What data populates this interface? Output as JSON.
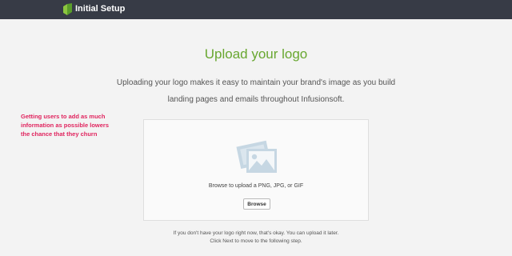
{
  "topbar": {
    "title": "Initial Setup",
    "logo_icon": "infusionsoft-logo-icon",
    "background": "#373b46"
  },
  "main": {
    "heading": "Upload your logo",
    "heading_color": "#68a730",
    "description_line1": "Uploading your logo makes it easy to maintain your brand's image as you build",
    "description_line2": "landing pages and emails throughout Infusionsoft."
  },
  "annotation": {
    "line1": "Getting users to add as much",
    "line2": "information as possible lowers",
    "line3": "the chance that they churn",
    "color": "#e0245e"
  },
  "upload": {
    "icon": "image-placeholder-icon",
    "hint": "Browse to upload a PNG, JPG, or GIF",
    "browse_label": "Browse"
  },
  "footer": {
    "line1": "If you don't have your logo right now, that's okay. You can upload it later.",
    "line2": "Click Next to move to the following step."
  }
}
